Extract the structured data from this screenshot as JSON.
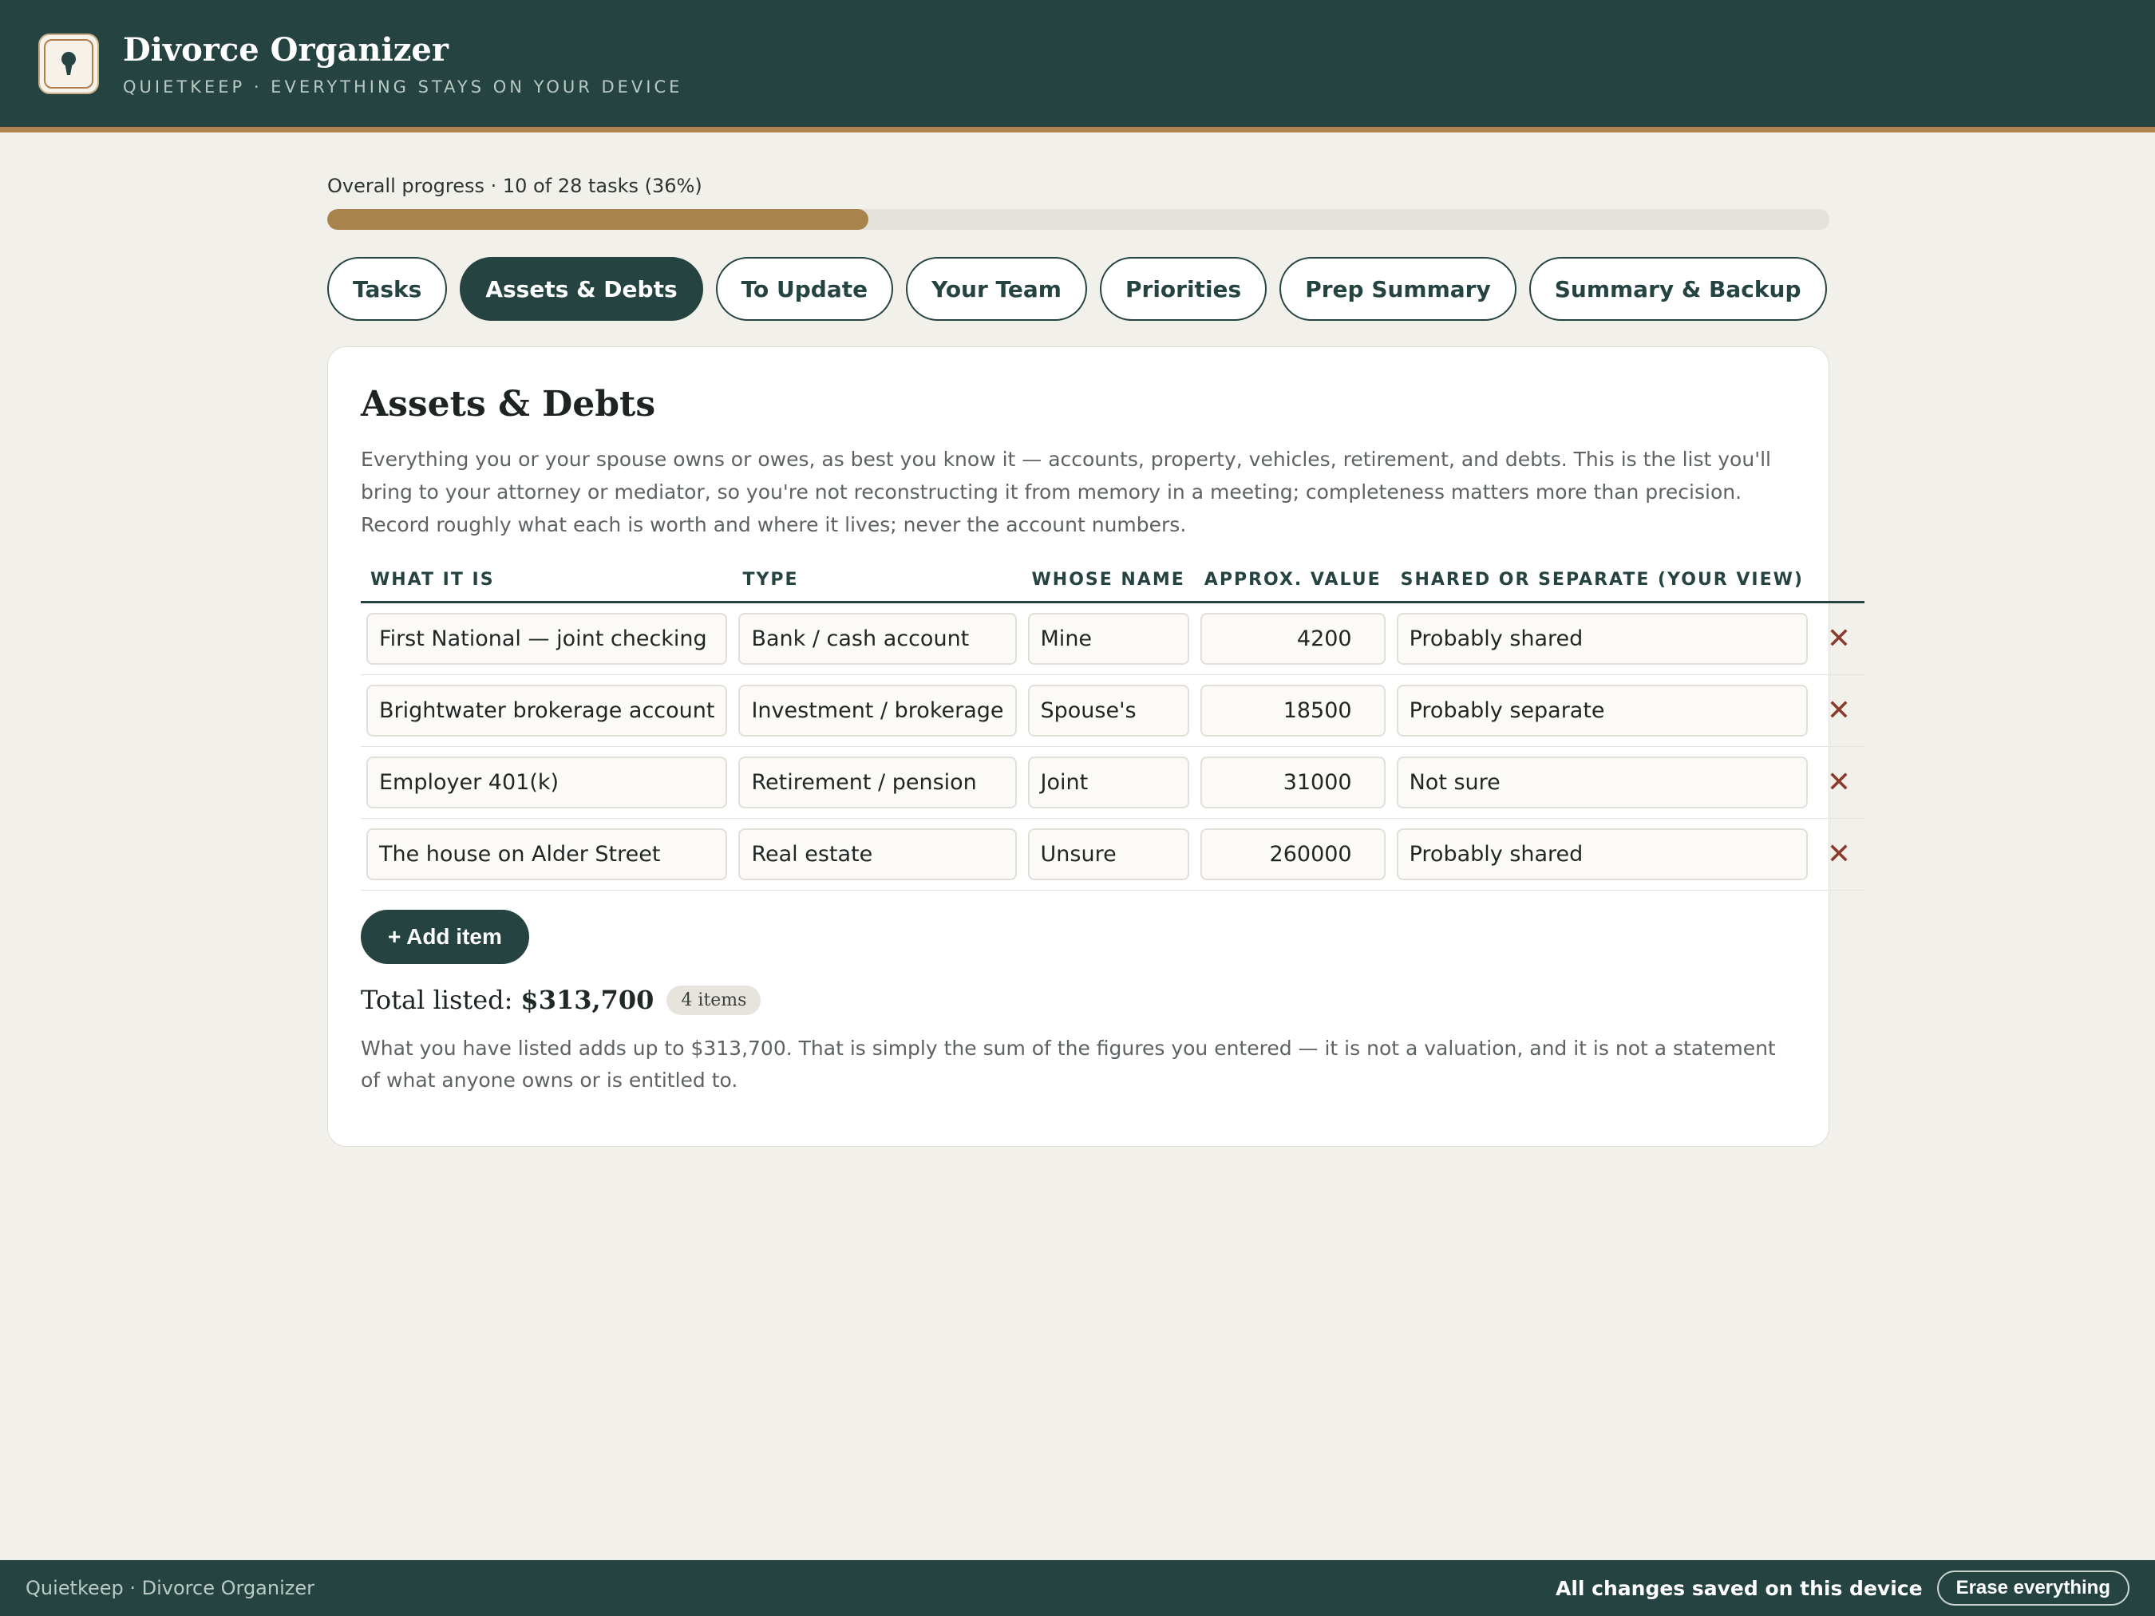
{
  "header": {
    "title": "Divorce Organizer",
    "subtitle": "QUIETKEEP · EVERYTHING STAYS ON YOUR DEVICE",
    "logo_icon": "keyhole-icon"
  },
  "progress": {
    "label": "Overall progress · 10 of 28 tasks (36%)",
    "completed": 10,
    "total": 28,
    "percent": 36
  },
  "tabs": [
    {
      "label": "Tasks",
      "active": false
    },
    {
      "label": "Assets & Debts",
      "active": true
    },
    {
      "label": "To Update",
      "active": false
    },
    {
      "label": "Your Team",
      "active": false
    },
    {
      "label": "Priorities",
      "active": false
    },
    {
      "label": "Prep Summary",
      "active": false
    },
    {
      "label": "Summary & Backup",
      "active": false
    }
  ],
  "card": {
    "title": "Assets & Debts",
    "description": "Everything you or your spouse owns or owes, as best you know it — accounts, property, vehicles, retirement, and debts. This is the list you'll bring to your attorney or mediator, so you're not reconstructing it from memory in a meeting; completeness matters more than precision. Record roughly what each is worth and where it lives; never the account numbers."
  },
  "table": {
    "headers": [
      "WHAT IT IS",
      "TYPE",
      "WHOSE NAME",
      "APPROX. VALUE",
      "SHARED OR SEPARATE (YOUR VIEW)"
    ],
    "rows": [
      {
        "what": "First National — joint checking",
        "type": "Bank / cash account",
        "whose": "Mine",
        "value": "4200",
        "shared": "Probably shared"
      },
      {
        "what": "Brightwater brokerage account",
        "type": "Investment / brokerage",
        "whose": "Spouse's",
        "value": "18500",
        "shared": "Probably separate"
      },
      {
        "what": "Employer 401(k)",
        "type": "Retirement / pension",
        "whose": "Joint",
        "value": "31000",
        "shared": "Not sure"
      },
      {
        "what": "The house on Alder Street",
        "type": "Real estate",
        "whose": "Unsure",
        "value": "260000",
        "shared": "Probably shared"
      }
    ],
    "remove_icon": "close-icon"
  },
  "add_button": "+ Add item",
  "total": {
    "label": "Total listed:",
    "value": "$313,700",
    "count": "4 items",
    "note": "What you have listed adds up to $313,700. That is simply the sum of the figures you entered — it is not a valuation, and it is not a statement of what anyone owns or is entitled to."
  },
  "footer": {
    "left": "Quietkeep · Divorce Organizer",
    "saved": "All changes saved on this device",
    "erase": "Erase everything"
  },
  "colors": {
    "primary": "#254340",
    "accent": "#a8834c",
    "background": "#f2f0eb"
  }
}
